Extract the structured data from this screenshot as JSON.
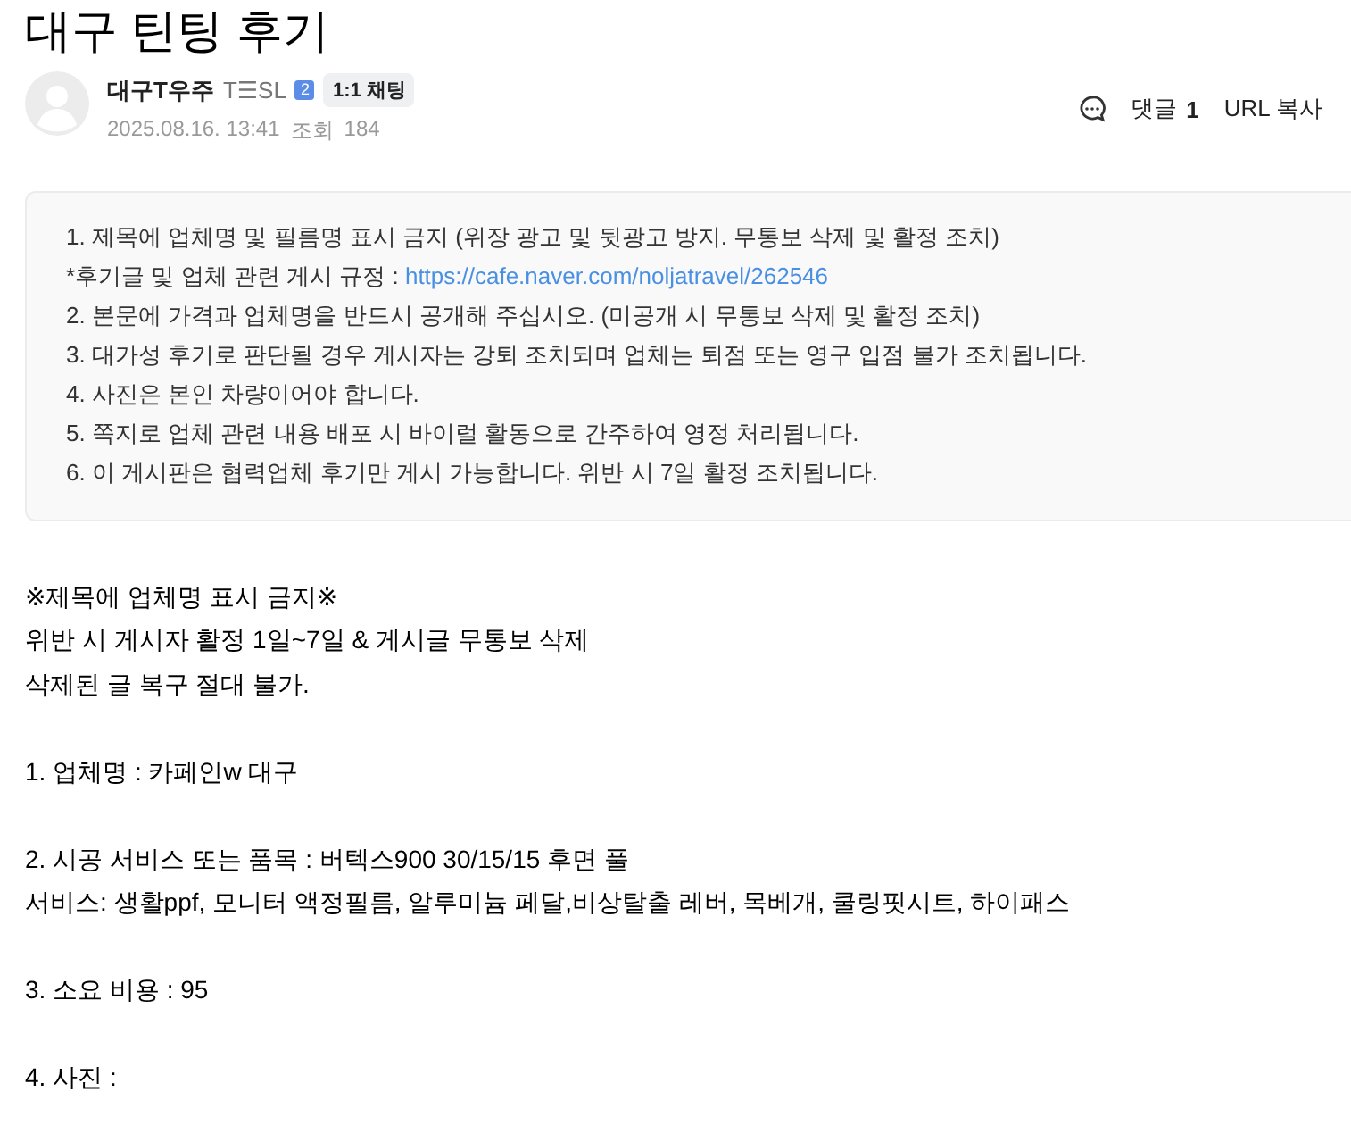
{
  "title": "대구 틴팅 후기",
  "author": {
    "name": "대구T우주",
    "nickname_tag": "T☰SL",
    "level": "2",
    "chat_button": "1:1 채팅",
    "date": "2025.08.16. 13:41",
    "views_label": "조회",
    "views": "184"
  },
  "actions": {
    "comments_label": "댓글",
    "comments_count": "1",
    "url_copy": "URL 복사"
  },
  "notice": [
    {
      "kind": "text",
      "text": "1. 제목에 업체명 및 필름명 표시 금지 (위장 광고 및 뒷광고 방지. 무통보 삭제 및 활정 조치)"
    },
    {
      "kind": "link",
      "text": "*후기글 및 업체 관련 게시 규정 : ",
      "link": "https://cafe.naver.com/noljatravel/262546"
    },
    {
      "kind": "text",
      "text": "2. 본문에 가격과 업체명을 반드시 공개해 주십시오. (미공개 시 무통보 삭제 및 활정 조치)"
    },
    {
      "kind": "text",
      "text": "3. 대가성 후기로 판단될 경우 게시자는 강퇴 조치되며 업체는 퇴점 또는 영구 입점 불가 조치됩니다."
    },
    {
      "kind": "text",
      "text": "4. 사진은 본인 차량이어야 합니다."
    },
    {
      "kind": "text",
      "text": "5. 쪽지로 업체 관련 내용 배포 시 바이럴 활동으로 간주하여 영정 처리됩니다."
    },
    {
      "kind": "text",
      "text": "6. 이 게시판은 협력업체 후기만 게시 가능합니다. 위반 시 7일 활정 조치됩니다."
    }
  ],
  "body": [
    [
      "※제목에 업체명 표시 금지※",
      "위반 시 게시자 활정 1일~7일 & 게시글 무통보 삭제",
      "삭제된 글 복구 절대 불가."
    ],
    [
      "1. 업체명 :  카페인w 대구"
    ],
    [
      "2. 시공 서비스 또는 품목 :  버텍스900 30/15/15 후면 풀",
      "서비스: 생활ppf, 모니터 액정필름, 알루미늄 페달,비상탈출 레버, 목베개, 쿨링핏시트, 하이패스"
    ],
    [
      "3. 소요 비용 :  95"
    ],
    [
      "4. 사진 :"
    ]
  ]
}
